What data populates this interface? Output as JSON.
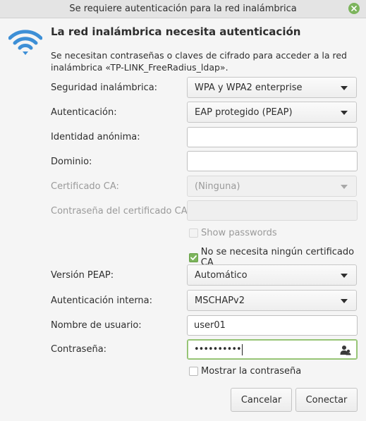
{
  "window": {
    "title": "Se requiere autenticación para la red inalámbrica"
  },
  "header": {
    "icon": "wifi-icon",
    "title": "La red inalámbrica necesita autenticación",
    "description": "Se necesitan contraseñas o claves de cifrado para acceder a la red inalámbrica «TP-LINK_FreeRadius_ldap»."
  },
  "form": {
    "security": {
      "label": "Seguridad inalámbrica:",
      "value": "WPA y WPA2 enterprise"
    },
    "authentication": {
      "label": "Autenticación:",
      "value": "EAP protegido (PEAP)"
    },
    "anonymous_identity": {
      "label": "Identidad anónima:",
      "value": ""
    },
    "domain": {
      "label": "Dominio:",
      "value": ""
    },
    "ca_certificate": {
      "label": "Certificado CA:",
      "value": "(Ninguna)",
      "disabled": true
    },
    "ca_cert_password": {
      "label": "Contraseña del certificado CA:",
      "value": "",
      "disabled": true
    },
    "show_passwords": {
      "label": "Show passwords",
      "checked": false,
      "disabled": true
    },
    "no_ca_required": {
      "label": "No se necesita ningún certificado CA",
      "checked": true
    },
    "peap_version": {
      "label": "Versión PEAP:",
      "value": "Automático"
    },
    "inner_auth": {
      "label": "Autenticación interna:",
      "value": "MSCHAPv2"
    },
    "username": {
      "label": "Nombre de usuario:",
      "value": "user01"
    },
    "password": {
      "label": "Contraseña:",
      "value": "••••••••••"
    },
    "show_password": {
      "label": "Mostrar la contraseña",
      "checked": false
    }
  },
  "buttons": {
    "cancel": "Cancelar",
    "connect": "Conectar"
  },
  "colors": {
    "accent": "#7cb45c",
    "wifi": "#3d8fd6"
  }
}
